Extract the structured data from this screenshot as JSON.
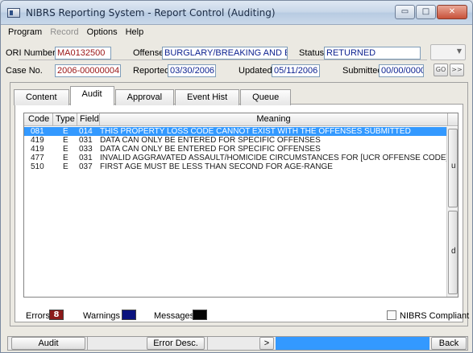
{
  "window": {
    "title": "NIBRS Reporting System - Report Control (Auditing)"
  },
  "caption_buttons": {
    "minimize": "▭",
    "maximize": "□",
    "close": "✕"
  },
  "menu": [
    {
      "label": "Program",
      "enabled": true
    },
    {
      "label": "Record",
      "enabled": false
    },
    {
      "label": "Options",
      "enabled": true
    },
    {
      "label": "Help",
      "enabled": true
    }
  ],
  "header": {
    "ori_label": "ORI Number",
    "ori_value": "MA0132500",
    "offense_label": "Offense",
    "offense_value": "BURGLARY/BREAKING AND ENT",
    "status_label": "Status",
    "status_value": "RETURNED",
    "case_label": "Case No.",
    "case_value": "2006-00000004",
    "reported_label": "Reported",
    "reported_value": "03/30/2006",
    "updated_label": "Updated",
    "updated_value": "05/11/2006",
    "submitted_label": "Submitted",
    "submitted_value": "00/00/0000",
    "go_label": "GO",
    "next_label": ">>"
  },
  "tabs": [
    {
      "label": "Content",
      "active": false
    },
    {
      "label": "Audit",
      "active": true
    },
    {
      "label": "Approval",
      "active": false
    },
    {
      "label": "Event Hist",
      "active": false
    },
    {
      "label": "Queue",
      "active": false
    }
  ],
  "grid": {
    "columns": [
      "Code",
      "Type",
      "Field",
      "Meaning"
    ],
    "rows": [
      {
        "code": "081",
        "type": "E",
        "field": "014",
        "meaning": "THIS PROPERTY LOSS CODE CANNOT EXIST WITH THE OFFENSES SUBMITTED",
        "selected": true
      },
      {
        "code": "419",
        "type": "E",
        "field": "031",
        "meaning": "DATA CAN ONLY BE ENTERED FOR SPECIFIC OFFENSES",
        "selected": false
      },
      {
        "code": "419",
        "type": "E",
        "field": "033",
        "meaning": "DATA CAN ONLY BE ENTERED FOR SPECIFIC OFFENSES",
        "selected": false
      },
      {
        "code": "477",
        "type": "E",
        "field": "031",
        "meaning": "INVALID AGGRAVATED ASSAULT/HOMICIDE CIRCUMSTANCES FOR [UCR OFFENSE CODE] OFI",
        "selected": false
      },
      {
        "code": "510",
        "type": "E",
        "field": "037",
        "meaning": "FIRST AGE MUST BE LESS THAN SECOND FOR AGE-RANGE",
        "selected": false
      }
    ],
    "scroll_up_letter": "u",
    "scroll_down_letter": "d"
  },
  "legend": {
    "errors_label": "Errors",
    "errors_count": "8",
    "warnings_label": "Warnings",
    "messages_label": "Messages",
    "compliant_label": "NIBRS Compliant"
  },
  "colors": {
    "errors": "#8b1a1a",
    "warnings": "#0b137e",
    "messages": "#050505",
    "selection": "#3399ff",
    "field_text": "#0a1f8f"
  },
  "bottom": {
    "audit_label": "Audit",
    "error_desc_label": "Error Desc.",
    "arrow_label": ">",
    "back_label": "Back"
  }
}
